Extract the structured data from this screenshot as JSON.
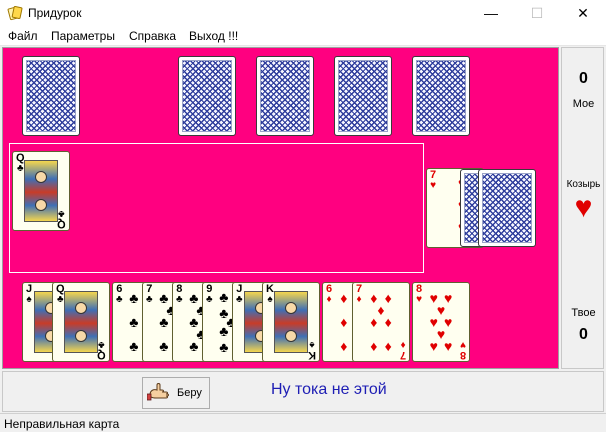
{
  "window": {
    "title": "Придурок",
    "minimize": "—",
    "maximize": "☐",
    "close": "✕"
  },
  "menu": [
    "Файл",
    "Параметры",
    "Справка",
    "Выход !!!"
  ],
  "opponent": {
    "cards_face_down": 5
  },
  "table": {
    "played": [
      {
        "rank": "Q",
        "suit": "♣"
      }
    ]
  },
  "deck": {
    "trump_card": {
      "rank": "7",
      "suit": "♥"
    }
  },
  "hand": [
    {
      "rank": "J",
      "suit": "♠"
    },
    {
      "rank": "Q",
      "suit": "♣"
    },
    {
      "rank": "6",
      "suit": "♣"
    },
    {
      "rank": "7",
      "suit": "♣"
    },
    {
      "rank": "8",
      "suit": "♣"
    },
    {
      "rank": "9",
      "suit": "♣"
    },
    {
      "rank": "J",
      "suit": "♣"
    },
    {
      "rank": "K",
      "suit": "♠"
    },
    {
      "rank": "6",
      "suit": "♦"
    },
    {
      "rank": "7",
      "suit": "♦"
    },
    {
      "rank": "8",
      "suit": "♥"
    }
  ],
  "side": {
    "opponent_score": "0",
    "opponent_label": "Мое",
    "trump_label": "Козырь",
    "trump_suit": "♥",
    "player_score": "0",
    "player_label": "Твое"
  },
  "controls": {
    "take_label": "Беру",
    "message": "Ну тока не этой"
  },
  "status": "Неправильная карта",
  "colors": {
    "table": "#ff0080",
    "message": "#1e1eb4",
    "red_suit": "#e00000"
  }
}
